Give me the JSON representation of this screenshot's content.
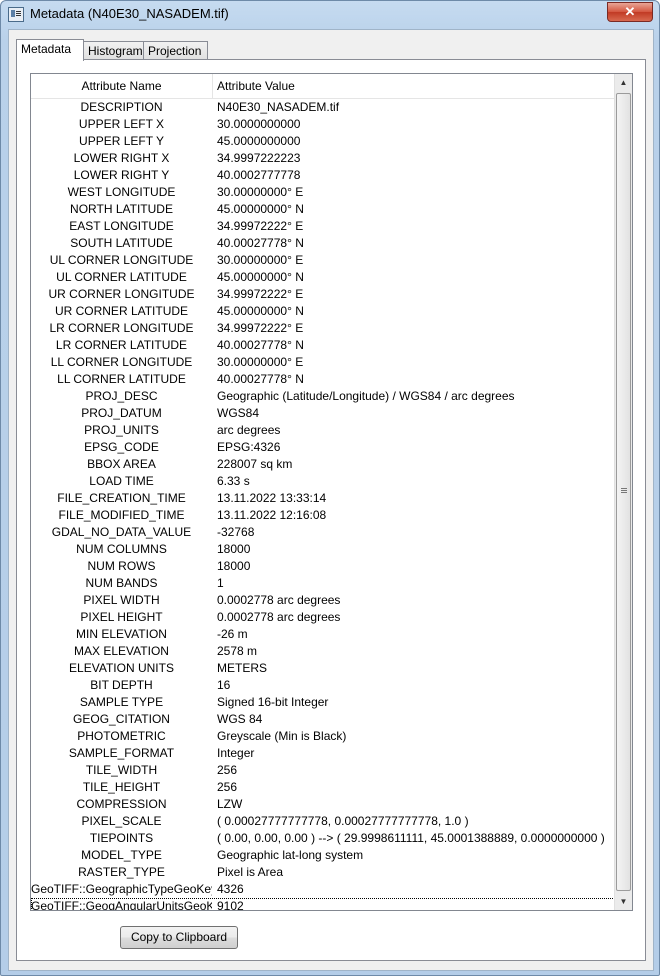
{
  "window": {
    "title": "Metadata (N40E30_NASADEM.tif)",
    "close_glyph": "✕",
    "icon": "app-icon"
  },
  "tabs": [
    {
      "label": "Metadata",
      "active": true
    },
    {
      "label": "Histogram",
      "active": false
    },
    {
      "label": "Projection",
      "active": false
    }
  ],
  "table": {
    "headers": {
      "name": "Attribute Name",
      "value": "Attribute Value"
    },
    "rows": [
      {
        "name": "DESCRIPTION",
        "value": "N40E30_NASADEM.tif"
      },
      {
        "name": "UPPER LEFT X",
        "value": "30.0000000000"
      },
      {
        "name": "UPPER LEFT Y",
        "value": "45.0000000000"
      },
      {
        "name": "LOWER RIGHT X",
        "value": "34.9997222223"
      },
      {
        "name": "LOWER RIGHT Y",
        "value": "40.0002777778"
      },
      {
        "name": "WEST LONGITUDE",
        "value": "30.00000000° E"
      },
      {
        "name": "NORTH LATITUDE",
        "value": "45.00000000° N"
      },
      {
        "name": "EAST LONGITUDE",
        "value": "34.99972222° E"
      },
      {
        "name": "SOUTH LATITUDE",
        "value": "40.00027778° N"
      },
      {
        "name": "UL CORNER LONGITUDE",
        "value": "30.00000000° E"
      },
      {
        "name": "UL CORNER LATITUDE",
        "value": "45.00000000° N"
      },
      {
        "name": "UR CORNER LONGITUDE",
        "value": "34.99972222° E"
      },
      {
        "name": "UR CORNER LATITUDE",
        "value": "45.00000000° N"
      },
      {
        "name": "LR CORNER LONGITUDE",
        "value": "34.99972222° E"
      },
      {
        "name": "LR CORNER LATITUDE",
        "value": "40.00027778° N"
      },
      {
        "name": "LL CORNER LONGITUDE",
        "value": "30.00000000° E"
      },
      {
        "name": "LL CORNER LATITUDE",
        "value": "40.00027778° N"
      },
      {
        "name": "PROJ_DESC",
        "value": "Geographic (Latitude/Longitude) / WGS84 / arc degrees"
      },
      {
        "name": "PROJ_DATUM",
        "value": "WGS84"
      },
      {
        "name": "PROJ_UNITS",
        "value": "arc degrees"
      },
      {
        "name": "EPSG_CODE",
        "value": "EPSG:4326"
      },
      {
        "name": "BBOX AREA",
        "value": "228007 sq km"
      },
      {
        "name": "LOAD TIME",
        "value": "6.33 s"
      },
      {
        "name": "FILE_CREATION_TIME",
        "value": "13.11.2022 13:33:14"
      },
      {
        "name": "FILE_MODIFIED_TIME",
        "value": "13.11.2022 12:16:08"
      },
      {
        "name": "GDAL_NO_DATA_VALUE",
        "value": "-32768"
      },
      {
        "name": "NUM COLUMNS",
        "value": "18000"
      },
      {
        "name": "NUM ROWS",
        "value": "18000"
      },
      {
        "name": "NUM BANDS",
        "value": "1"
      },
      {
        "name": "PIXEL WIDTH",
        "value": "0.0002778 arc degrees"
      },
      {
        "name": "PIXEL HEIGHT",
        "value": "0.0002778 arc degrees"
      },
      {
        "name": "MIN ELEVATION",
        "value": "-26 m"
      },
      {
        "name": "MAX ELEVATION",
        "value": "2578 m"
      },
      {
        "name": "ELEVATION UNITS",
        "value": "METERS"
      },
      {
        "name": "BIT DEPTH",
        "value": "16"
      },
      {
        "name": "SAMPLE TYPE",
        "value": "Signed 16-bit Integer"
      },
      {
        "name": "GEOG_CITATION",
        "value": "WGS 84"
      },
      {
        "name": "PHOTOMETRIC",
        "value": "Greyscale (Min is Black)"
      },
      {
        "name": "SAMPLE_FORMAT",
        "value": "Integer"
      },
      {
        "name": "TILE_WIDTH",
        "value": "256"
      },
      {
        "name": "TILE_HEIGHT",
        "value": "256"
      },
      {
        "name": "COMPRESSION",
        "value": "LZW"
      },
      {
        "name": "PIXEL_SCALE",
        "value": "( 0.00027777777778, 0.00027777777778, 1.0 )"
      },
      {
        "name": "TIEPOINTS",
        "value": "( 0.00, 0.00, 0.00 ) --> ( 29.9998611111, 45.0001388889, 0.0000000000 )"
      },
      {
        "name": "MODEL_TYPE",
        "value": "Geographic lat-long system"
      },
      {
        "name": "RASTER_TYPE",
        "value": "Pixel is Area"
      },
      {
        "name": "GeoTIFF::GeographicTypeGeoKey",
        "value": "4326"
      },
      {
        "name": "GeoTIFF::GeogAngularUnitsGeoKey",
        "value": "9102",
        "focused": true
      }
    ]
  },
  "scrollbar": {
    "up_glyph": "▲",
    "down_glyph": "▼"
  },
  "buttons": {
    "copy": "Copy to Clipboard"
  }
}
